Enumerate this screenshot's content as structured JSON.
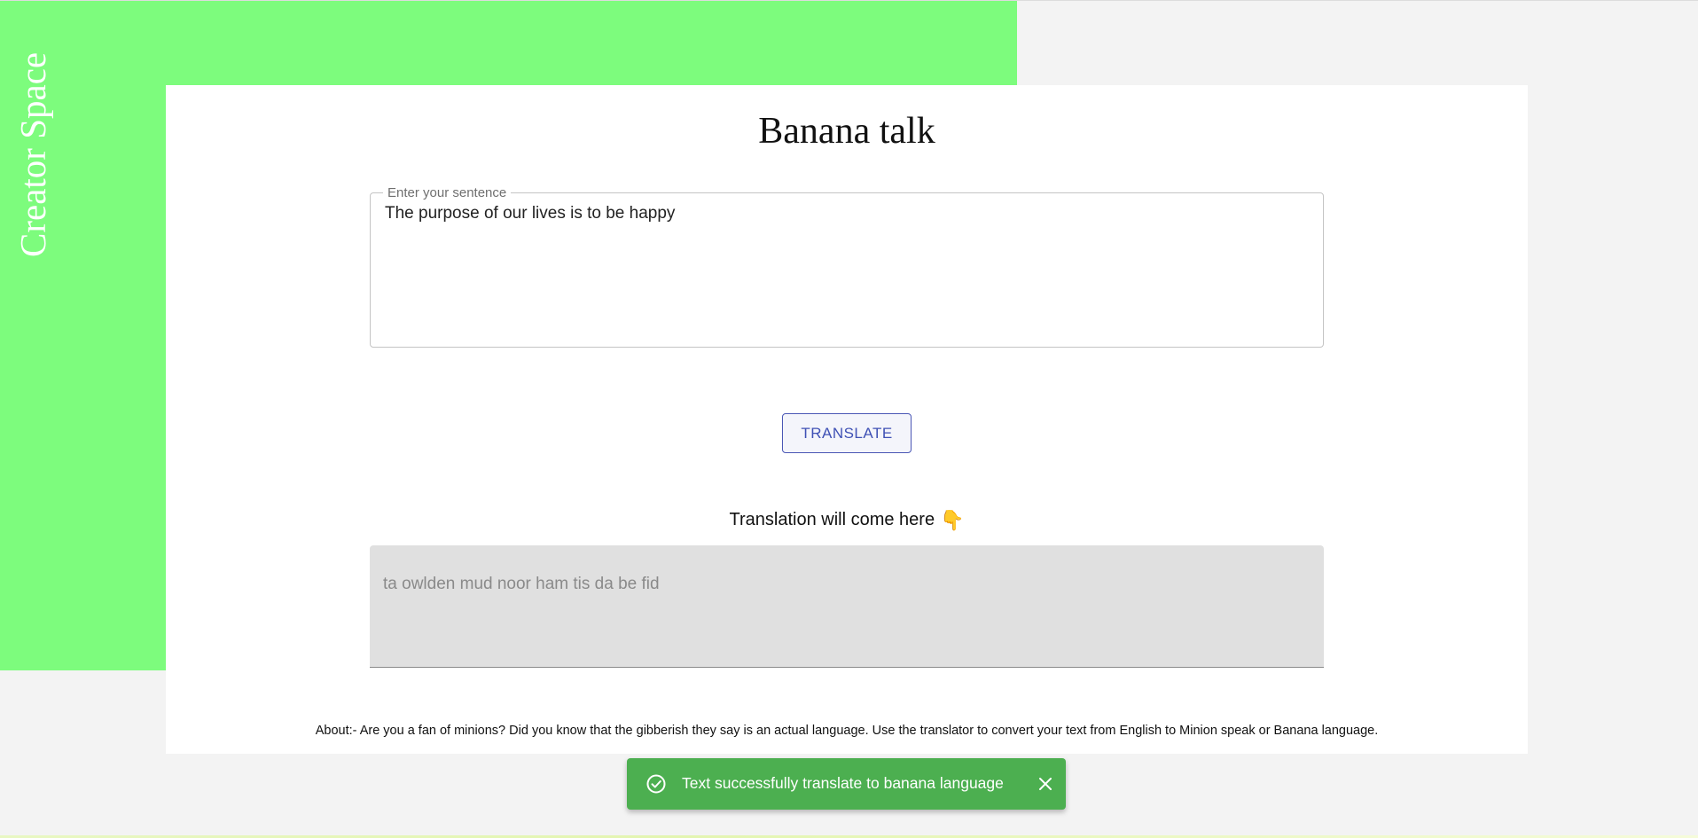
{
  "sidebar": {
    "title": "Creator Space"
  },
  "app": {
    "title": "Banana talk"
  },
  "input": {
    "label": "Enter your sentence",
    "value": "The purpose of our lives is to be happy"
  },
  "translate_button": {
    "label": "TRANSLATE"
  },
  "output": {
    "heading": "Translation will come here",
    "heading_icon": "backhand-index-pointing-down-icon",
    "value": "ta owlden mud noor ham tis da be fid"
  },
  "about": {
    "text": "About:- Are you a fan of minions? Did you know that the gibberish they say is an actual language. Use the translator to convert your text from English to Minion speak or Banana language."
  },
  "snackbar": {
    "message": "Text successfully translate to banana language",
    "icon": "check-circle-icon",
    "close_icon": "close-icon"
  },
  "colors": {
    "green_background": "#7dfc7d",
    "primary": "#3f51b5",
    "success": "#4caf50",
    "page_background": "#f3f3f3"
  }
}
